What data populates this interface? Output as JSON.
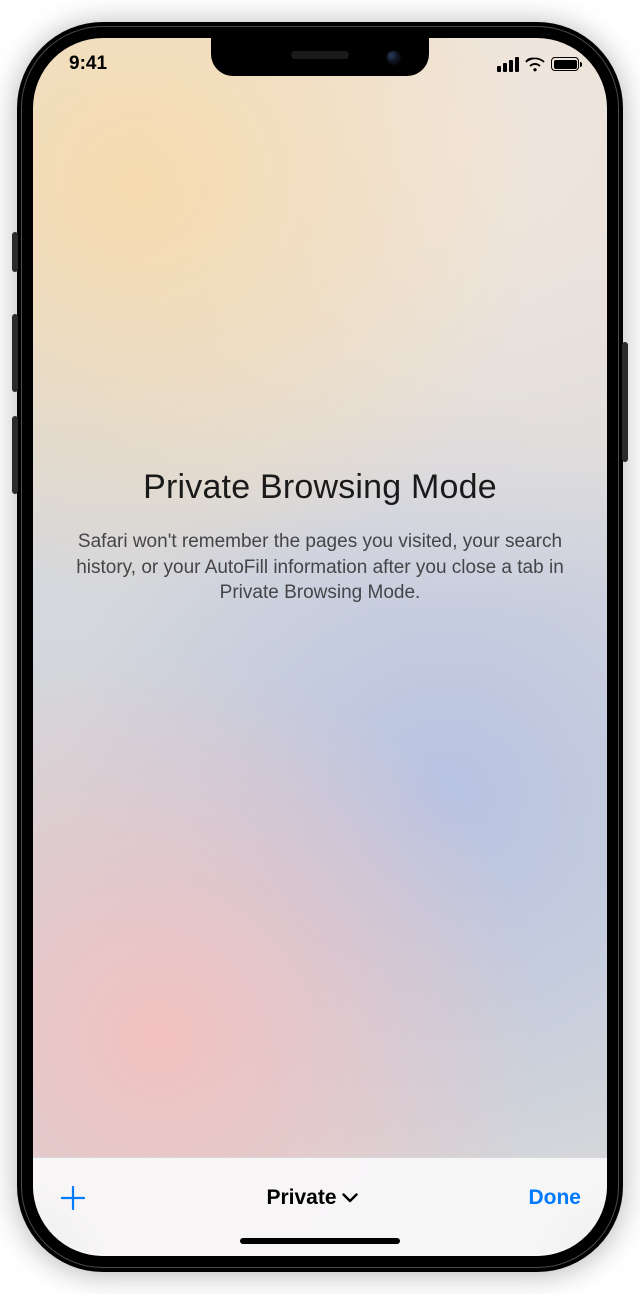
{
  "status": {
    "time": "9:41"
  },
  "main": {
    "title": "Private Browsing Mode",
    "description": "Safari won't remember the pages you visited, your search history, or your AutoFill information after you close a tab in Private Browsing Mode."
  },
  "toolbar": {
    "tab_group_label": "Private",
    "done_label": "Done"
  }
}
